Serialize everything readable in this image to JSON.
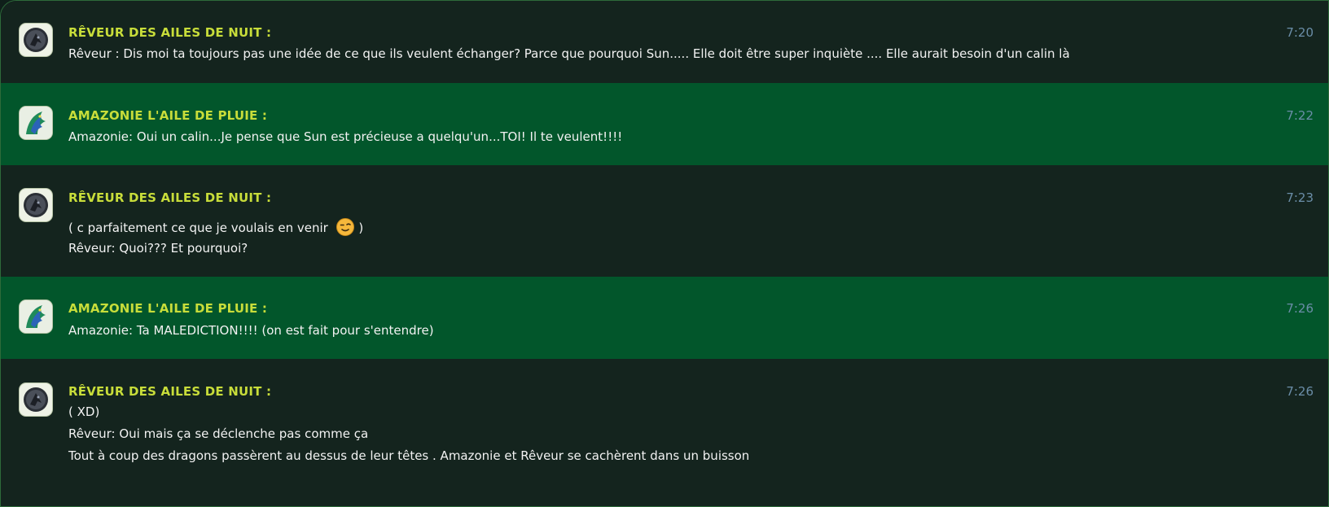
{
  "messages": [
    {
      "author": "RÊVEUR DES AILES DE NUIT :",
      "time": "7:20",
      "avatar_icon": "dark-dragon-avatar-icon",
      "lines": [
        "Rêveur : Dis moi ta toujours pas une idée de ce que ils veulent échanger? Parce que pourquoi Sun..... Elle doit être super inquiète .... Elle aurait besoin d'un calin là"
      ]
    },
    {
      "author": "AMAZONIE L'AILE DE PLUIE :",
      "time": "7:22",
      "avatar_icon": "rainwing-dragon-avatar-icon",
      "lines": [
        "Amazonie: Oui un calin...Je pense que Sun est précieuse a quelqu'un...TOI! Il te veulent!!!!"
      ]
    },
    {
      "author": "RÊVEUR DES AILES DE NUIT :",
      "time": "7:23",
      "avatar_icon": "dark-dragon-avatar-icon",
      "lines": [
        "( c parfaitement ce que je voulais en venir",
        ")",
        "Rêveur: Quoi??? Et pourquoi?"
      ],
      "emoji_icon": "winking-smiley-icon"
    },
    {
      "author": "AMAZONIE L'AILE DE PLUIE :",
      "time": "7:26",
      "avatar_icon": "rainwing-dragon-avatar-icon",
      "lines": [
        "Amazonie: Ta MALEDICTION!!!! (on est fait pour s'entendre)"
      ]
    },
    {
      "author": "RÊVEUR DES AILES DE NUIT :",
      "time": "7:26",
      "avatar_icon": "dark-dragon-avatar-icon",
      "lines": [
        "( XD)",
        "Rêveur: Oui mais ça se déclenche pas comme ça",
        "Tout à coup des dragons passèrent au dessus de leur têtes . Amazonie et Rêveur se cachèrent dans un buisson"
      ]
    }
  ],
  "colors": {
    "dark_row": "#14241e",
    "green_row": "#02562b",
    "author": "#c8dd3a",
    "time": "#6b8ea8",
    "text": "#f2f2f2"
  }
}
